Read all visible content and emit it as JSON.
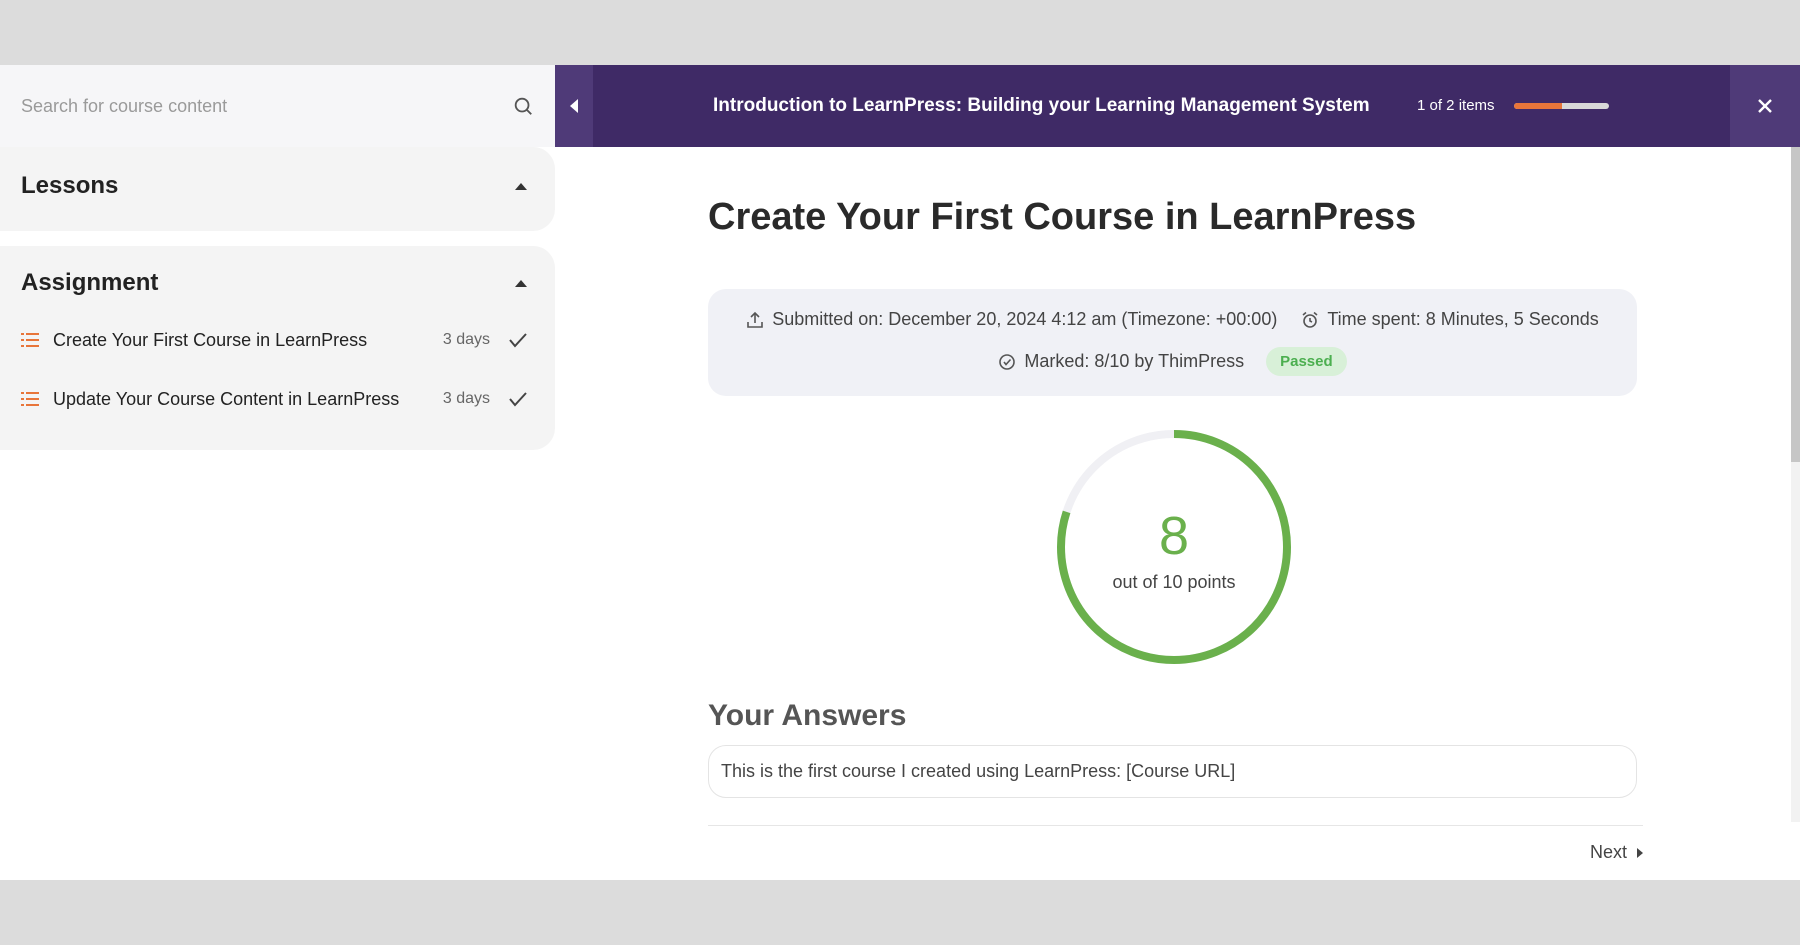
{
  "sidebar": {
    "search_placeholder": "Search for course content",
    "sections": [
      {
        "title": "Lessons",
        "items": []
      },
      {
        "title": "Assignment",
        "items": [
          {
            "label": "Create Your First Course in LearnPress",
            "duration": "3 days",
            "completed": true
          },
          {
            "label": "Update Your Course Content in LearnPress",
            "duration": "3 days",
            "completed": true
          }
        ]
      }
    ]
  },
  "topbar": {
    "course_title": "Introduction to LearnPress: Building your Learning Management System",
    "items_count": "1 of 2 items",
    "progress_fraction": 0.5,
    "colors": {
      "bar_bg": "#3f2a66",
      "progress": "#e8753a"
    }
  },
  "assignment": {
    "title": "Create Your First Course in LearnPress",
    "submitted": "Submitted on: December 20, 2024 4:12 am (Timezone: +00:00)",
    "time_spent": "Time spent: 8 Minutes, 5 Seconds",
    "marked": "Marked: 8/10 by ThimPress",
    "status": "Passed",
    "score": "8",
    "score_sub": "out of 10 points",
    "score_fraction": 0.8,
    "answers_title": "Your Answers",
    "answer_text": "This is the first course I created using LearnPress: [Course URL]",
    "next_label": "Next",
    "colors": {
      "score": "#6ab04c",
      "passed_bg": "#d8f0d8",
      "passed_text": "#4caf50"
    }
  }
}
